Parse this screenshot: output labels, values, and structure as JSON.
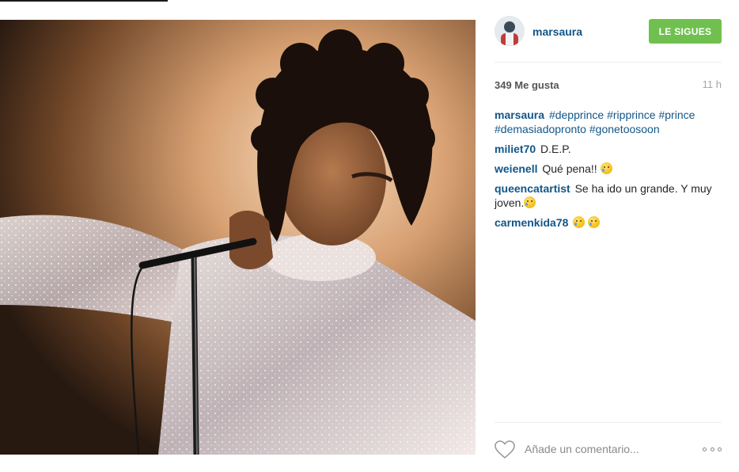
{
  "post": {
    "image_alt": "Concert photo: performer with curly hair at a microphone wearing a sheer sparkly ruffled blouse",
    "author": {
      "username": "marsaura",
      "follow_label": "LE SIGUES"
    },
    "likes_text": "349 Me gusta",
    "time_ago": "11 h",
    "caption": {
      "username": "marsaura",
      "hashtags": [
        "#depprince",
        "#ripprince",
        "#prince",
        "#demasiadopronto",
        "#gonetoosoon"
      ]
    },
    "comments": [
      {
        "username": "miliet70",
        "text": "D.E.P."
      },
      {
        "username": "weienell",
        "text": "Qué pena!!"
      },
      {
        "username": "queencatartist",
        "text": "Se ha ido un grande. Y muy joven."
      },
      {
        "username": "carmenkida78",
        "text": ""
      }
    ],
    "comment_input_placeholder": "Añade un comentario...",
    "icons": {
      "like": "heart-outline-icon",
      "more": "more-options-icon",
      "emoji": "crying-face-emoji"
    },
    "colors": {
      "username": "#125688",
      "follow_button": "#70c050",
      "text": "#262626",
      "muted": "#a5a7aa"
    }
  }
}
